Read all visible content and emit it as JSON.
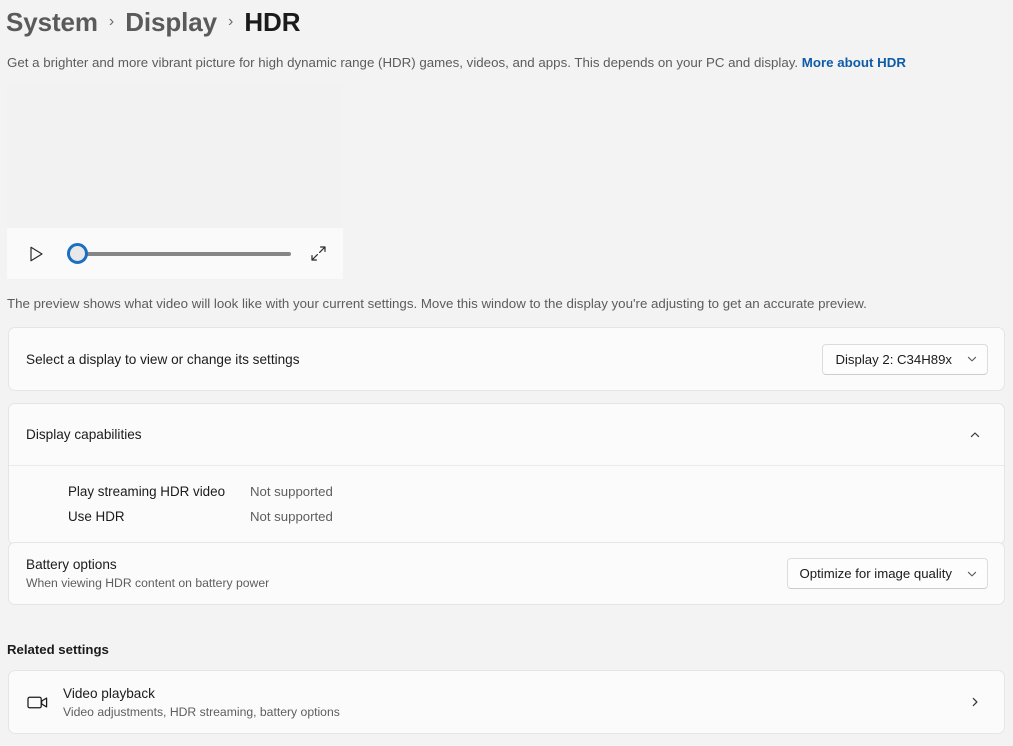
{
  "breadcrumb": {
    "items": [
      "System",
      "Display",
      "HDR"
    ],
    "separator": "›"
  },
  "description": {
    "text": "Get a brighter and more vibrant picture for high dynamic range (HDR) games, videos, and apps. This depends on your PC and display. ",
    "link_label": "More about HDR"
  },
  "player": {
    "play_icon": "play-triangle-icon",
    "expand_icon": "fullscreen-expand-icon",
    "slider_value": 0,
    "slider_min": 0,
    "slider_max": 100,
    "thumb_accent": "#1a6fc4",
    "track_color": "#868686"
  },
  "preview_caption": "The preview shows what video will look like with your current settings. Move this window to the display you're adjusting to get an accurate preview.",
  "display_select": {
    "label": "Select a display to view or change its settings",
    "value": "Display 2: C34H89x",
    "chevron": "chevron-down-icon"
  },
  "capabilities": {
    "title": "Display capabilities",
    "expanded": true,
    "chevron": "chevron-up-icon",
    "rows": [
      {
        "label": "Play streaming HDR video",
        "value": "Not supported"
      },
      {
        "label": "Use HDR",
        "value": "Not supported"
      }
    ]
  },
  "battery": {
    "title": "Battery options",
    "subtitle": "When viewing HDR content on battery power",
    "value": "Optimize for image quality",
    "chevron": "chevron-down-icon"
  },
  "related": {
    "section_label": "Related settings",
    "items": [
      {
        "icon": "video-camera-icon",
        "title": "Video playback",
        "subtitle": "Video adjustments, HDR streaming, battery options",
        "chevron": "chevron-right-icon"
      }
    ]
  }
}
